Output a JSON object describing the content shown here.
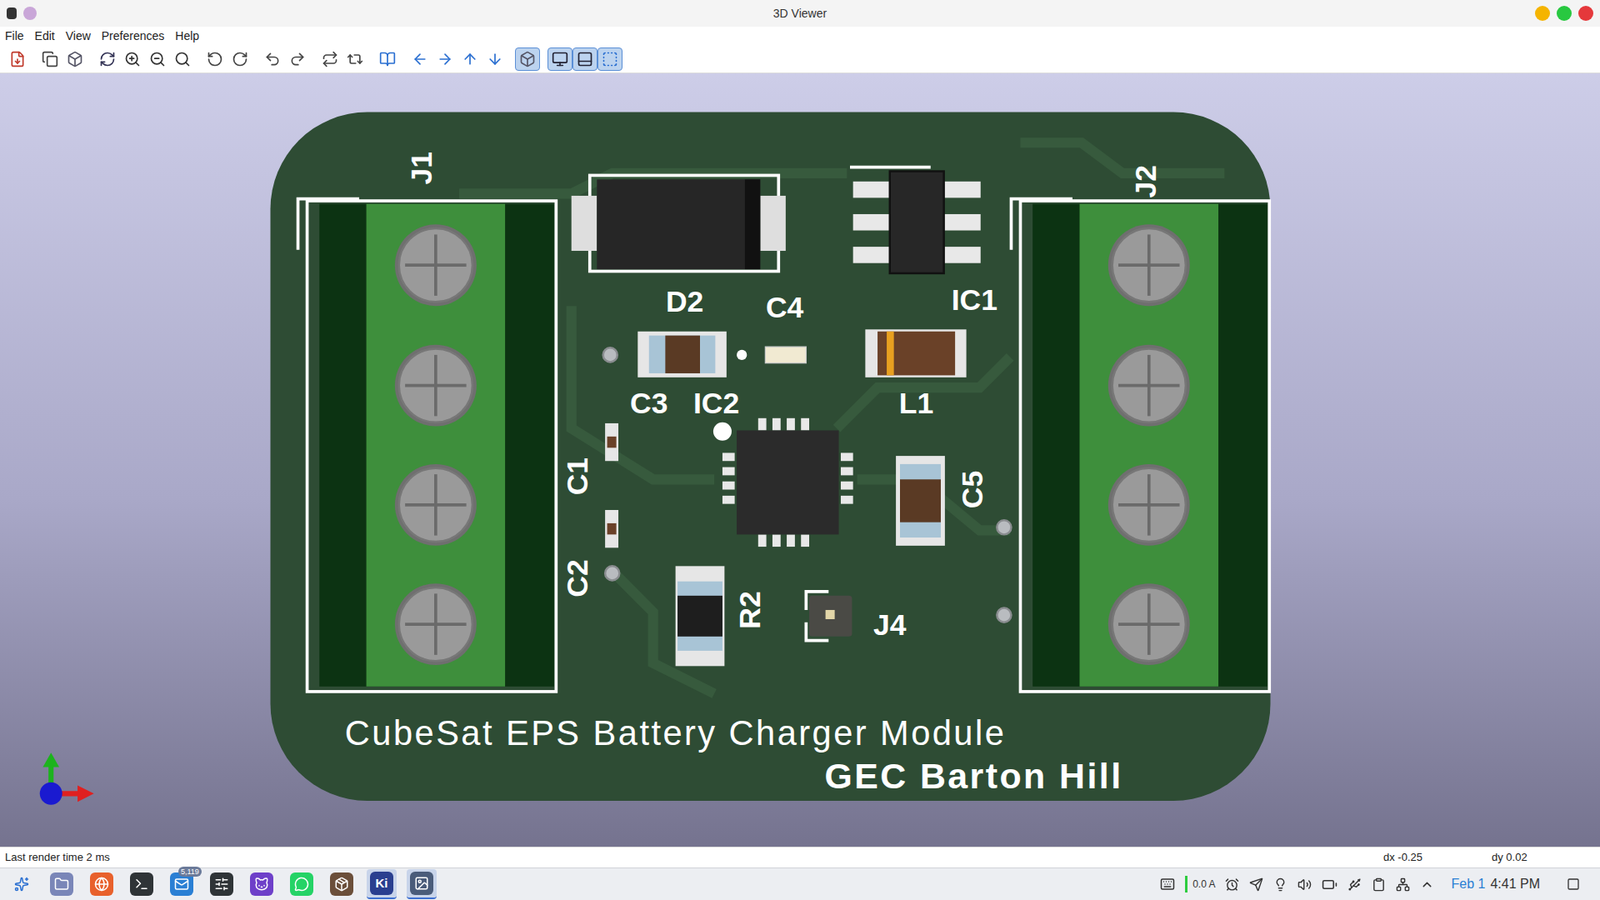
{
  "window": {
    "title": "3D Viewer"
  },
  "menu": [
    "File",
    "Edit",
    "View",
    "Preferences",
    "Help"
  ],
  "toolbar": [
    {
      "selected": false
    },
    {
      "selected": false
    },
    {
      "selected": false
    },
    {
      "selected": false
    },
    {
      "selected": false
    },
    {
      "selected": false
    },
    {
      "selected": false
    },
    {
      "selected": false
    },
    {
      "selected": false
    },
    {
      "selected": false
    },
    {
      "selected": false
    },
    {
      "selected": false
    },
    {
      "selected": false
    },
    {
      "selected": false
    },
    {
      "selected": false
    },
    {
      "selected": false
    },
    {
      "selected": false
    },
    {
      "selected": false
    },
    {
      "selected": true
    },
    {
      "selected": true
    },
    {
      "selected": true
    },
    {
      "selected": true
    }
  ],
  "board": {
    "designators": [
      "J1",
      "J2",
      "D2",
      "C4",
      "IC1",
      "C3",
      "IC2",
      "L1",
      "C1",
      "C2",
      "C5",
      "R2",
      "J4"
    ],
    "title_lines": [
      "CubeSat EPS Battery Charger Module",
      "GEC Barton Hill"
    ]
  },
  "status_bar": {
    "message": "Last render time 2 ms",
    "dx": "dx -0.25",
    "dy": "dy 0.02"
  },
  "taskbar": {
    "apps": [
      {
        "text": "",
        "badge": "",
        "selected": false
      },
      {
        "text": "",
        "badge": "",
        "selected": false
      },
      {
        "text": "",
        "badge": "",
        "selected": false
      },
      {
        "text": "",
        "badge": "",
        "selected": false
      },
      {
        "text": "",
        "badge": "5,119",
        "selected": false
      },
      {
        "text": "",
        "badge": "",
        "selected": false
      },
      {
        "text": "",
        "badge": "",
        "selected": false
      },
      {
        "text": "",
        "badge": "",
        "selected": false
      },
      {
        "text": "",
        "badge": "",
        "selected": false
      },
      {
        "text": "Ki",
        "badge": "",
        "selected": true
      },
      {
        "text": "",
        "badge": "",
        "selected": true
      }
    ],
    "tray": {
      "current": "0.0 A",
      "date": "Feb 1",
      "time": "4:41 PM"
    }
  }
}
